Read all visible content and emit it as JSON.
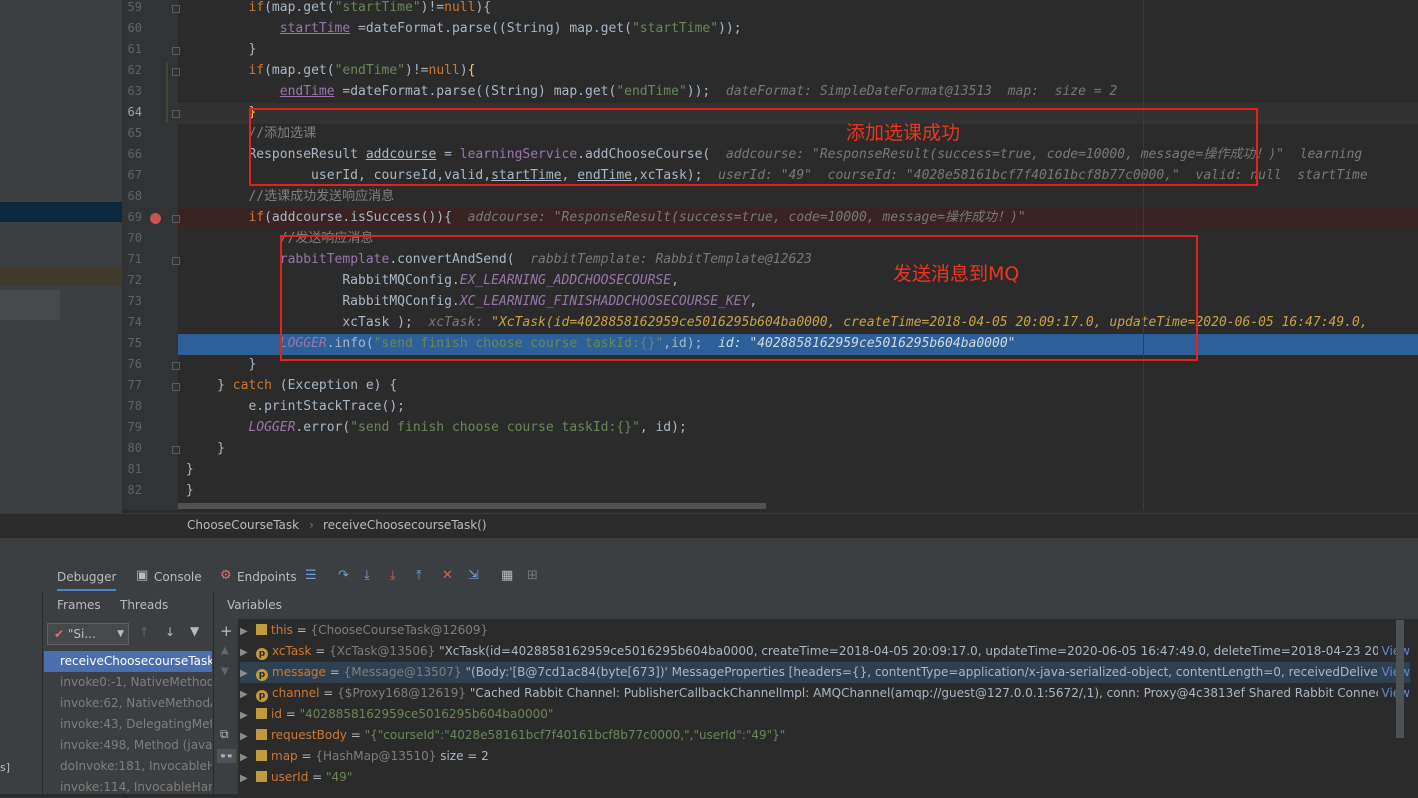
{
  "editor": {
    "lines": [
      {
        "num": "59",
        "html": "<span class=\"w\">        </span><span class=\"k\">if</span>(map.get(<span class=\"s\">\"startTime\"</span>)!=<span class=\"k\">null</span>){"
      },
      {
        "num": "60",
        "html": "            <span class=\"f u\" style=\"color:#9876aa;font-style:normal\">startTime</span> =dateFormat.parse((String) map.get(<span class=\"s\">\"startTime\"</span>));"
      },
      {
        "num": "61",
        "html": "        }"
      },
      {
        "num": "62",
        "html": "        <span class=\"k\">if</span>(map.get(<span class=\"s\">\"endTime\"</span>)!=<span class=\"k\">null</span>)<span class=\"m\">{</span>"
      },
      {
        "num": "63",
        "html": "            <span class=\"u\" style=\"color:#9876aa\">endTime</span> =dateFormat.parse((String) map.get(<span class=\"s\">\"endTime\"</span>));  <span class=\"hint\">dateFormat: SimpleDateFormat@13513  map:  size = 2</span>"
      },
      {
        "num": "64",
        "html": "        <span class=\"m\">}</span>"
      },
      {
        "num": "65",
        "html": "        <span class=\"c\">//添加选课</span>"
      },
      {
        "num": "66",
        "html": "        ResponseResult <span class=\"u\">addcourse</span> = <span style=\"color:#9876aa\">learningService</span>.addChooseCourse(  <span class=\"hint\">addcourse: \"ResponseResult(success=true, code=10000, message=操作成功！)\"  learning</span>"
      },
      {
        "num": "67",
        "html": "                userId, courseId,valid,<span class=\"u\">startTime</span>, <span class=\"u\">endTime</span>,xcTask);  <span class=\"hint\">userId: \"49\"  courseId: \"4028e58161bcf7f40161bcf8b77c0000,\"  valid: null  startTime</span>"
      },
      {
        "num": "68",
        "html": "        <span class=\"c\">//选课成功发送响应消息</span>"
      },
      {
        "num": "69",
        "html": "        <span class=\"k\">if</span>(addcourse.isSuccess()){  <span class=\"hint\">addcourse: \"ResponseResult(success=true, code=10000, message=操作成功！)\"</span>"
      },
      {
        "num": "70",
        "html": "            <span class=\"c\">//发送响应消息</span>"
      },
      {
        "num": "71",
        "html": "            <span style=\"color:#9876aa\">rabbitTemplate</span>.convertAndSend(  <span class=\"hint\">rabbitTemplate: RabbitTemplate@12623</span>"
      },
      {
        "num": "72",
        "html": "                    RabbitMQConfig.<span class=\"f\">EX_LEARNING_ADDCHOOSECOURSE</span>,"
      },
      {
        "num": "73",
        "html": "                    RabbitMQConfig.<span class=\"f\">XC_LEARNING_FINISHADDCHOOSECOURSE_KEY</span>,"
      },
      {
        "num": "74",
        "html": "                    xcTask );  <span class=\"hint\">xcTask: </span><span class=\"hint\" style=\"color:#c8a24a\">\"XcTask(id=4028858162959ce5016295b604ba0000, createTime=2018-04-05 20:09:17.0, updateTime=2020-06-05 16:47:49.0,</span>"
      },
      {
        "num": "75",
        "html": "            <span class=\"f\">LOGGER</span>.info(<span class=\"s\">\"send finish choose course taskId:{}\"</span>,id);  <span class=\"hint\" style=\"color:#d0d8e0\">id: \"4028858162959ce5016295b604ba0000\"</span>"
      },
      {
        "num": "76",
        "html": "        }"
      },
      {
        "num": "77",
        "html": "    } <span class=\"k\">catch</span> (Exception e) {"
      },
      {
        "num": "78",
        "html": "        e.printStackTrace();"
      },
      {
        "num": "79",
        "html": "        <span class=\"f\">LOGGER</span>.error(<span class=\"s\">\"send finish choose course taskId:{}\"</span>, id);"
      },
      {
        "num": "80",
        "html": "    }"
      },
      {
        "num": "81",
        "html": "}"
      },
      {
        "num": "82",
        "html": "}"
      }
    ],
    "annotation1": "添加选课成功",
    "annotation2": "发送消息到MQ"
  },
  "breadcrumb": {
    "class_name": "ChooseCourseTask",
    "method_name": "receiveChoosecourseTask()"
  },
  "toolbar": {
    "debugger_tab": "Debugger",
    "console_tab": "Console",
    "endpoints_tab": "Endpoints"
  },
  "frames_panel": {
    "frames_tab": "Frames",
    "threads_tab": "Threads",
    "thread_select": "\"Si...",
    "items": [
      "receiveChoosecourseTask:",
      "invoke0:-1, NativeMethodA",
      "invoke:62, NativeMethodA",
      "invoke:43, DelegatingMeth",
      "invoke:498, Method (java.l",
      "doInvoke:181, InvocableHa",
      "invoke:114, InvocableHand"
    ]
  },
  "variables": {
    "header": "Variables",
    "view_link": "View",
    "rows": [
      {
        "badge": "box",
        "name": "this",
        "eq": " = ",
        "type": "{ChooseCourseTask@12609}",
        "value": ""
      },
      {
        "badge": "p",
        "name": "xcTask",
        "eq": " = ",
        "type": "{XcTask@13506}",
        "value": " \"XcTask(id=4028858162959ce5016295b604ba0000, createTime=2018-04-05 20:09:17.0, updateTime=2020-06-05 16:47:49.0, deleteTime=2018-04-23 20:09:21.0,...",
        "link": true
      },
      {
        "badge": "p",
        "name": "message",
        "eq": " = ",
        "type": "{Message@13507}",
        "value": " \"(Body:'[B@7cd1ac84(byte[673])' MessageProperties [headers={}, contentType=application/x-java-serialized-object, contentLength=0, receivedDeliveryMoc...",
        "link": true,
        "sel": true
      },
      {
        "badge": "p",
        "name": "channel",
        "eq": " = ",
        "type": "{$Proxy168@12619}",
        "value": " \"Cached Rabbit Channel: PublisherCallbackChannelImpl: AMQChannel(amqp://guest@127.0.0.1:5672/,1), conn: Proxy@4c3813ef Shared Rabbit Connection: ...",
        "link": true
      },
      {
        "badge": "box",
        "name": "id",
        "eq": " = ",
        "type": "",
        "value": "\"4028858162959ce5016295b604ba0000\"",
        "str": true
      },
      {
        "badge": "box",
        "name": "requestBody",
        "eq": " = ",
        "type": "",
        "value": "\"{\"courseId\":\"4028e58161bcf7f40161bcf8b77c0000,\",\"userId\":\"49\"}\"",
        "str": true
      },
      {
        "badge": "box",
        "name": "map",
        "eq": " = ",
        "type": "{HashMap@13510}",
        "value": "  size = 2"
      },
      {
        "badge": "box",
        "name": "userId",
        "eq": " = ",
        "type": "",
        "value": "\"49\"",
        "str": true
      }
    ]
  },
  "left_edge_label": "s]"
}
